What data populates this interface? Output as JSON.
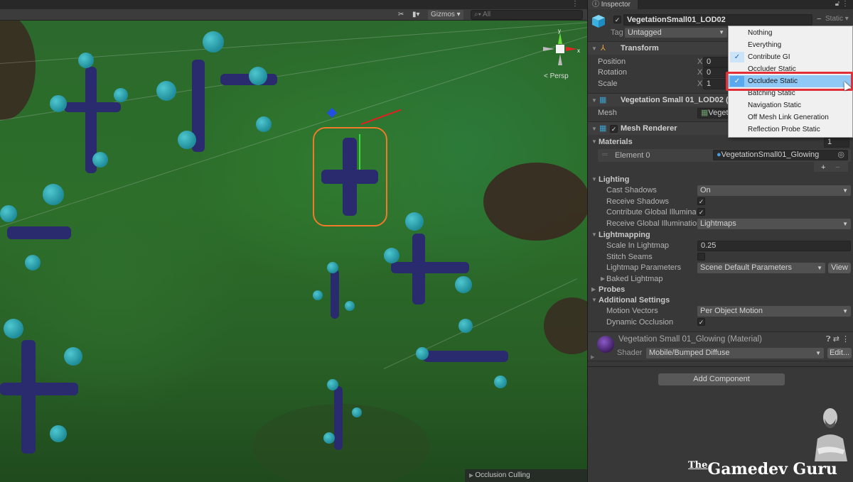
{
  "scene": {
    "toolbar": {
      "tools_icon": "tools-icon",
      "camera_icon": "camera-icon",
      "gizmos_label": "Gizmos",
      "search_placeholder": "All"
    },
    "orientation_gizmo": {
      "y_label": "y",
      "x_label": "x"
    },
    "projection_label": "< Persp",
    "overlay_panel": {
      "label": "Occlusion Culling"
    }
  },
  "inspector": {
    "tab_label": "Inspector",
    "object": {
      "active": true,
      "name": "VegetationSmall01_LOD02",
      "static_label": "Static",
      "tag_label": "Tag",
      "tag_value": "Untagged"
    },
    "transform": {
      "title": "Transform",
      "rows": [
        {
          "label": "Position",
          "axis": "X",
          "value": "0"
        },
        {
          "label": "Rotation",
          "axis": "X",
          "value": "0"
        },
        {
          "label": "Scale",
          "axis": "X",
          "value": "1"
        }
      ]
    },
    "mesh_filter": {
      "title": "Vegetation Small 01_LOD02 (Mes",
      "mesh_label": "Mesh",
      "mesh_value": "Vegetat"
    },
    "mesh_renderer": {
      "title": "Mesh Renderer",
      "enabled": true,
      "materials_label": "Materials",
      "materials_count": "1",
      "element_label": "Element 0",
      "element_value": "VegetationSmall01_Glowing",
      "add_label": "+",
      "remove_label": "−",
      "lighting": {
        "label": "Lighting",
        "cast_shadows_label": "Cast Shadows",
        "cast_shadows_value": "On",
        "receive_shadows_label": "Receive Shadows",
        "receive_shadows": true,
        "contribute_gi_label": "Contribute Global Illumination",
        "contribute_gi": true,
        "receive_gi_label": "Receive Global Illumination",
        "receive_gi_value": "Lightmaps"
      },
      "lightmapping": {
        "label": "Lightmapping",
        "scale_label": "Scale In Lightmap",
        "scale_value": "0.25",
        "stitch_label": "Stitch Seams",
        "stitch": false,
        "params_label": "Lightmap Parameters",
        "params_value": "Scene Default Parameters",
        "view_label": "View",
        "baked_label": "Baked Lightmap"
      },
      "probes_label": "Probes",
      "additional": {
        "label": "Additional Settings",
        "motion_label": "Motion Vectors",
        "motion_value": "Per Object Motion",
        "dynamic_label": "Dynamic Occlusion",
        "dynamic": true
      }
    },
    "material": {
      "title": "Vegetation Small 01_Glowing (Material)",
      "shader_label": "Shader",
      "shader_value": "Mobile/Bumped Diffuse",
      "edit_label": "Edit..."
    },
    "add_component_label": "Add Component"
  },
  "static_menu": {
    "items": [
      {
        "label": "Nothing",
        "checked": false,
        "highlighted": false
      },
      {
        "label": "Everything",
        "checked": false,
        "highlighted": false
      },
      {
        "label": "Contribute GI",
        "checked": true,
        "highlighted": false
      },
      {
        "label": "Occluder Static",
        "checked": false,
        "highlighted": false
      },
      {
        "label": "Occludee Static",
        "checked": true,
        "highlighted": true
      },
      {
        "label": "Batching Static",
        "checked": false,
        "highlighted": false
      },
      {
        "label": "Navigation Static",
        "checked": false,
        "highlighted": false
      },
      {
        "label": "Off Mesh Link Generation",
        "checked": false,
        "highlighted": false
      },
      {
        "label": "Reflection Probe Static",
        "checked": false,
        "highlighted": false
      }
    ],
    "highlight_color": "#e0313b"
  },
  "branding": {
    "the": "The",
    "name": "Gamedev Guru"
  },
  "glyphs": {
    "check": "✓",
    "fold_open": "▼",
    "fold_closed": "▶",
    "arrow_down": "▼"
  }
}
